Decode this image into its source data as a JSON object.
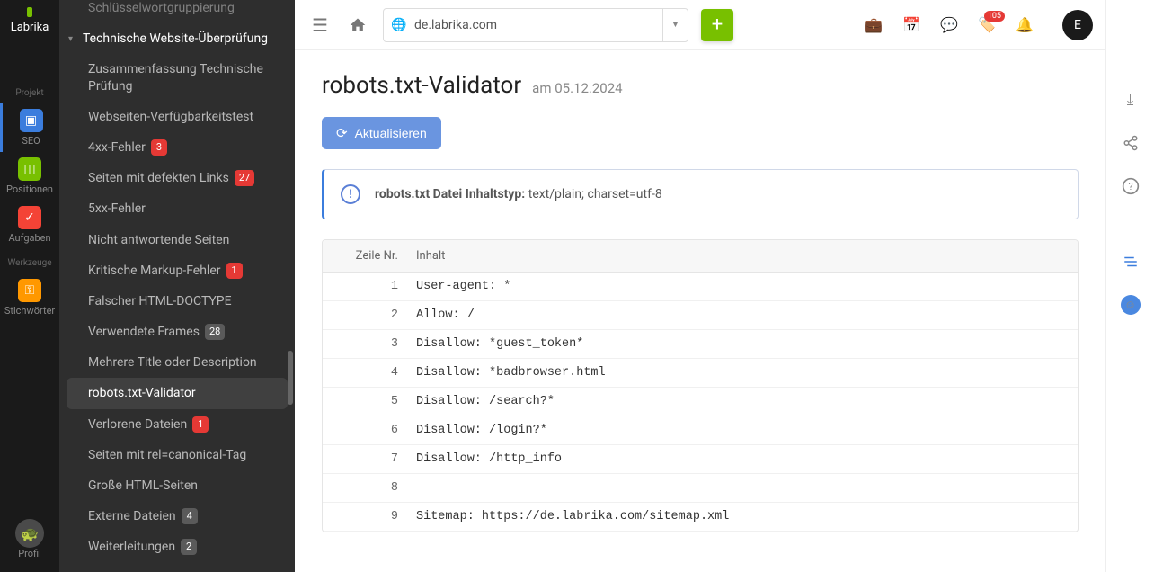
{
  "brand": "Labrika",
  "rail": {
    "section1": "Projekt",
    "seo": "SEO",
    "positions": "Positionen",
    "tasks": "Aufgaben",
    "section2": "Werkzeuge",
    "keywords": "Stichwörter",
    "profile": "Profil"
  },
  "sidebar": {
    "items": [
      {
        "label": "Schlüsselwortgruppierung",
        "kind": "sub-trunc"
      },
      {
        "label": "Technische Website-Überprüfung",
        "kind": "parent"
      },
      {
        "label": "Zusammenfassung Technische Prüfung",
        "kind": "sub"
      },
      {
        "label": "Webseiten-Verfügbarkeitstest",
        "kind": "sub"
      },
      {
        "label": "4xx-Fehler",
        "kind": "sub",
        "badge": "3",
        "badgeColor": "red"
      },
      {
        "label": "Seiten mit defekten Links",
        "kind": "sub",
        "badge": "27",
        "badgeColor": "red"
      },
      {
        "label": "5xx-Fehler",
        "kind": "sub"
      },
      {
        "label": "Nicht antwortende Seiten",
        "kind": "sub"
      },
      {
        "label": "Kritische Markup-Fehler",
        "kind": "sub",
        "badge": "1",
        "badgeColor": "red"
      },
      {
        "label": "Falscher HTML-DOCTYPE",
        "kind": "sub"
      },
      {
        "label": "Verwendete Frames",
        "kind": "sub",
        "badge": "28",
        "badgeColor": "gray"
      },
      {
        "label": "Mehrere Title oder Description",
        "kind": "sub"
      },
      {
        "label": "robots.txt-Validator",
        "kind": "sub",
        "active": true
      },
      {
        "label": "Verlorene Dateien",
        "kind": "sub",
        "badge": "1",
        "badgeColor": "red"
      },
      {
        "label": "Seiten mit rel=canonical-Tag",
        "kind": "sub"
      },
      {
        "label": "Große HTML-Seiten",
        "kind": "sub"
      },
      {
        "label": "Externe Dateien",
        "kind": "sub",
        "badge": "4",
        "badgeColor": "gray"
      },
      {
        "label": "Weiterleitungen",
        "kind": "sub",
        "badge": "2",
        "badgeColor": "gray"
      }
    ]
  },
  "topbar": {
    "domain": "de.labrika.com",
    "tagBadge": "105",
    "userInitial": "E"
  },
  "page": {
    "title": "robots.txt-Validator",
    "datePrefix": "am ",
    "date": "05.12.2024",
    "refresh": "Aktualisieren",
    "infoLabel": "robots.txt Datei Inhaltstyp:",
    "infoValue": "text/plain; charset=utf-8",
    "colLine": "Zeile Nr.",
    "colContent": "Inhalt",
    "rows": [
      {
        "n": "1",
        "c": "User-agent: *"
      },
      {
        "n": "2",
        "c": "Allow: /"
      },
      {
        "n": "3",
        "c": "Disallow: *guest_token*"
      },
      {
        "n": "4",
        "c": "Disallow: *badbrowser.html"
      },
      {
        "n": "5",
        "c": "Disallow: /search?*"
      },
      {
        "n": "6",
        "c": "Disallow: /login?*"
      },
      {
        "n": "7",
        "c": "Disallow: /http_info"
      },
      {
        "n": "8",
        "c": ""
      },
      {
        "n": "9",
        "c": "Sitemap: https://de.labrika.com/sitemap.xml"
      }
    ]
  }
}
